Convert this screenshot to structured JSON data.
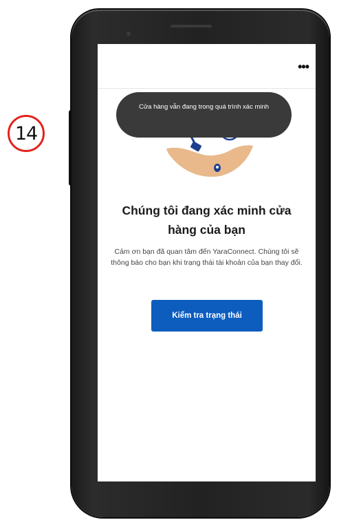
{
  "step": {
    "number": "14"
  },
  "header": {
    "more_menu": "•••"
  },
  "toast": {
    "message": "Cửa hàng vẫn đang trong quá trình xác minh"
  },
  "main": {
    "title": "Chúng tôi đang xác minh cửa hàng của bạn",
    "description": "Cảm ơn bạn đã quan tâm đến YaraConnect. Chúng tôi sẽ thông báo cho bạn khi trạng thái tài khoản của bạn thay đổi.",
    "check_status_label": "Kiểm tra trạng thái"
  },
  "colors": {
    "primary_button": "#0d5dbf",
    "toast_bg": "#3a3a3a",
    "badge_ring": "#e2231a"
  }
}
